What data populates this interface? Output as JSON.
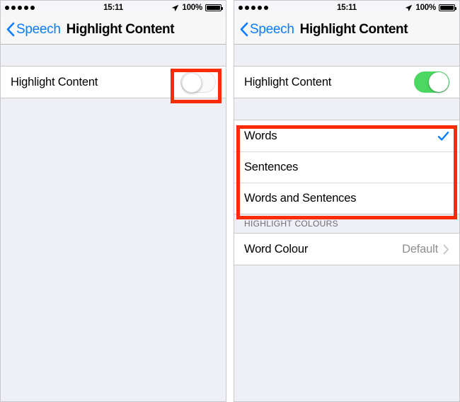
{
  "meta": {
    "accent_blue": "#0a7cff",
    "toggle_green": "#4cd763",
    "annotation_red": "#fb2c05",
    "value_gray": "#8e8e93"
  },
  "status_bar": {
    "signal_dots": 5,
    "time": "15:11",
    "location_icon": "location-arrow-icon",
    "battery_percent": "100%",
    "battery_level": 100
  },
  "nav": {
    "back_icon": "chevron-left-icon",
    "back_label": "Speech",
    "title": "Highlight Content"
  },
  "left_panel": {
    "name": "highlight-content-off-state",
    "toggle_row": {
      "label": "Highlight Content",
      "toggle_state": "off"
    }
  },
  "right_panel": {
    "name": "highlight-content-on-state",
    "toggle_row": {
      "label": "Highlight Content",
      "toggle_state": "on"
    },
    "options": [
      {
        "label": "Words",
        "selected": true
      },
      {
        "label": "Sentences",
        "selected": false
      },
      {
        "label": "Words and Sentences",
        "selected": false
      }
    ],
    "colours_section": {
      "header": "HIGHLIGHT COLOURS",
      "rows": [
        {
          "label": "Word Colour",
          "value": "Default",
          "accessory": "chevron-right-icon"
        }
      ]
    }
  },
  "annotations": [
    {
      "name": "highlight-toggle-callout",
      "target": "left toggle switch"
    },
    {
      "name": "highlight-options-callout",
      "target": "right options list"
    }
  ]
}
